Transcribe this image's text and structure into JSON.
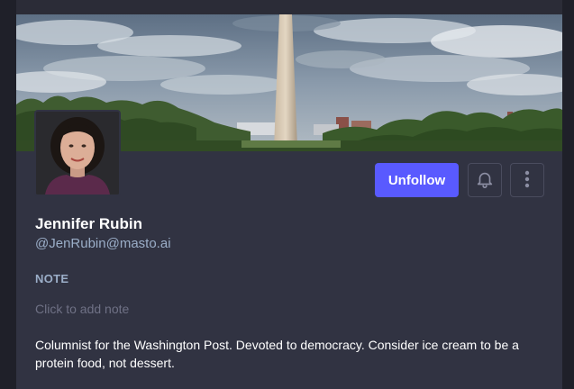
{
  "profile": {
    "display_name": "Jennifer Rubin",
    "handle": "@JenRubin@masto.ai",
    "bio": "Columnist for the Washington Post. Devoted to democracy. Consider ice cream to be a protein food, not dessert."
  },
  "actions": {
    "unfollow_label": "Unfollow",
    "notify_icon": "bell-icon",
    "more_icon": "vertical-dots-icon"
  },
  "note": {
    "label": "NOTE",
    "placeholder": "Click to add note"
  },
  "colors": {
    "background": "#1f2029",
    "card": "#313342",
    "accent": "#595aff",
    "secondary_text": "#9baec8",
    "placeholder_text": "#6f7185"
  }
}
